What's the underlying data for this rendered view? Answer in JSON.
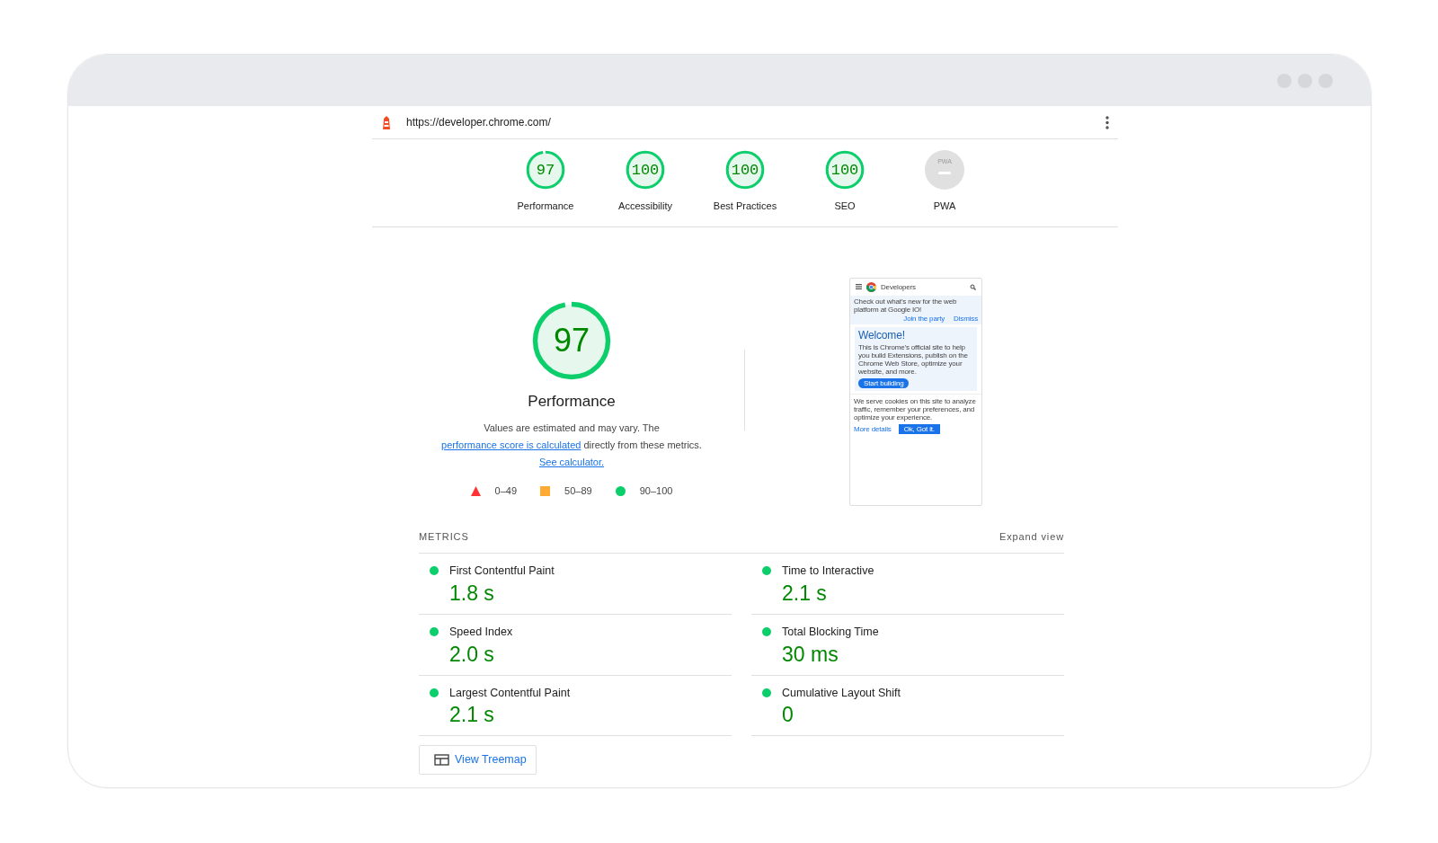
{
  "url": "https://developer.chrome.com/",
  "categories": [
    {
      "kind": "score",
      "score": "97",
      "level": 0.97,
      "label": "Performance"
    },
    {
      "kind": "score",
      "score": "100",
      "level": 1,
      "label": "Accessibility"
    },
    {
      "kind": "score",
      "score": "100",
      "level": 1,
      "label": "Best Practices"
    },
    {
      "kind": "score",
      "score": "100",
      "level": 1,
      "label": "SEO"
    },
    {
      "kind": "pwa",
      "badge": "PWA",
      "label": "PWA"
    }
  ],
  "performance": {
    "score": "97",
    "level": 0.97,
    "title": "Performance",
    "description": [
      "Values are estimated and may vary. The ",
      "performance score is calculated",
      " directly from these metrics. ",
      "See calculator."
    ],
    "legend": [
      {
        "kind": "triangle",
        "color": "#ff3333",
        "range": "0–49"
      },
      {
        "kind": "square",
        "color": "#ffaa33",
        "range": "50–89"
      },
      {
        "kind": "circle",
        "color": "#0cce6b",
        "range": "90–100"
      }
    ]
  },
  "screenshot": {
    "brand": "Developers",
    "banner": "Check out what's new for the web platform at Google IO!",
    "banner_links": [
      "Join the party",
      "Dismiss"
    ],
    "heading": "Welcome!",
    "body": "This is Chrome's official site to help you build Extensions, publish on the Chrome Web Store, optimize your website, and more.",
    "cta": "Start building",
    "cookie": "We serve cookies on this site to analyze traffic, remember your preferences, and optimize your experience.",
    "more": "More details",
    "ok": "Ok, Got it."
  },
  "metrics_header": "METRICS",
  "expand": "Expand view",
  "metrics": [
    {
      "name": "First Contentful Paint",
      "value": "1.8 s",
      "color": "#0cce6b"
    },
    {
      "name": "Time to Interactive",
      "value": "2.1 s",
      "color": "#0cce6b"
    },
    {
      "name": "Speed Index",
      "value": "2.0 s",
      "color": "#0cce6b"
    },
    {
      "name": "Total Blocking Time",
      "value": "30 ms",
      "color": "#0cce6b"
    },
    {
      "name": "Largest Contentful Paint",
      "value": "2.1 s",
      "color": "#0cce6b"
    },
    {
      "name": "Cumulative Layout Shift",
      "value": "0",
      "color": "#0cce6b"
    }
  ],
  "treemap_button": "View Treemap"
}
